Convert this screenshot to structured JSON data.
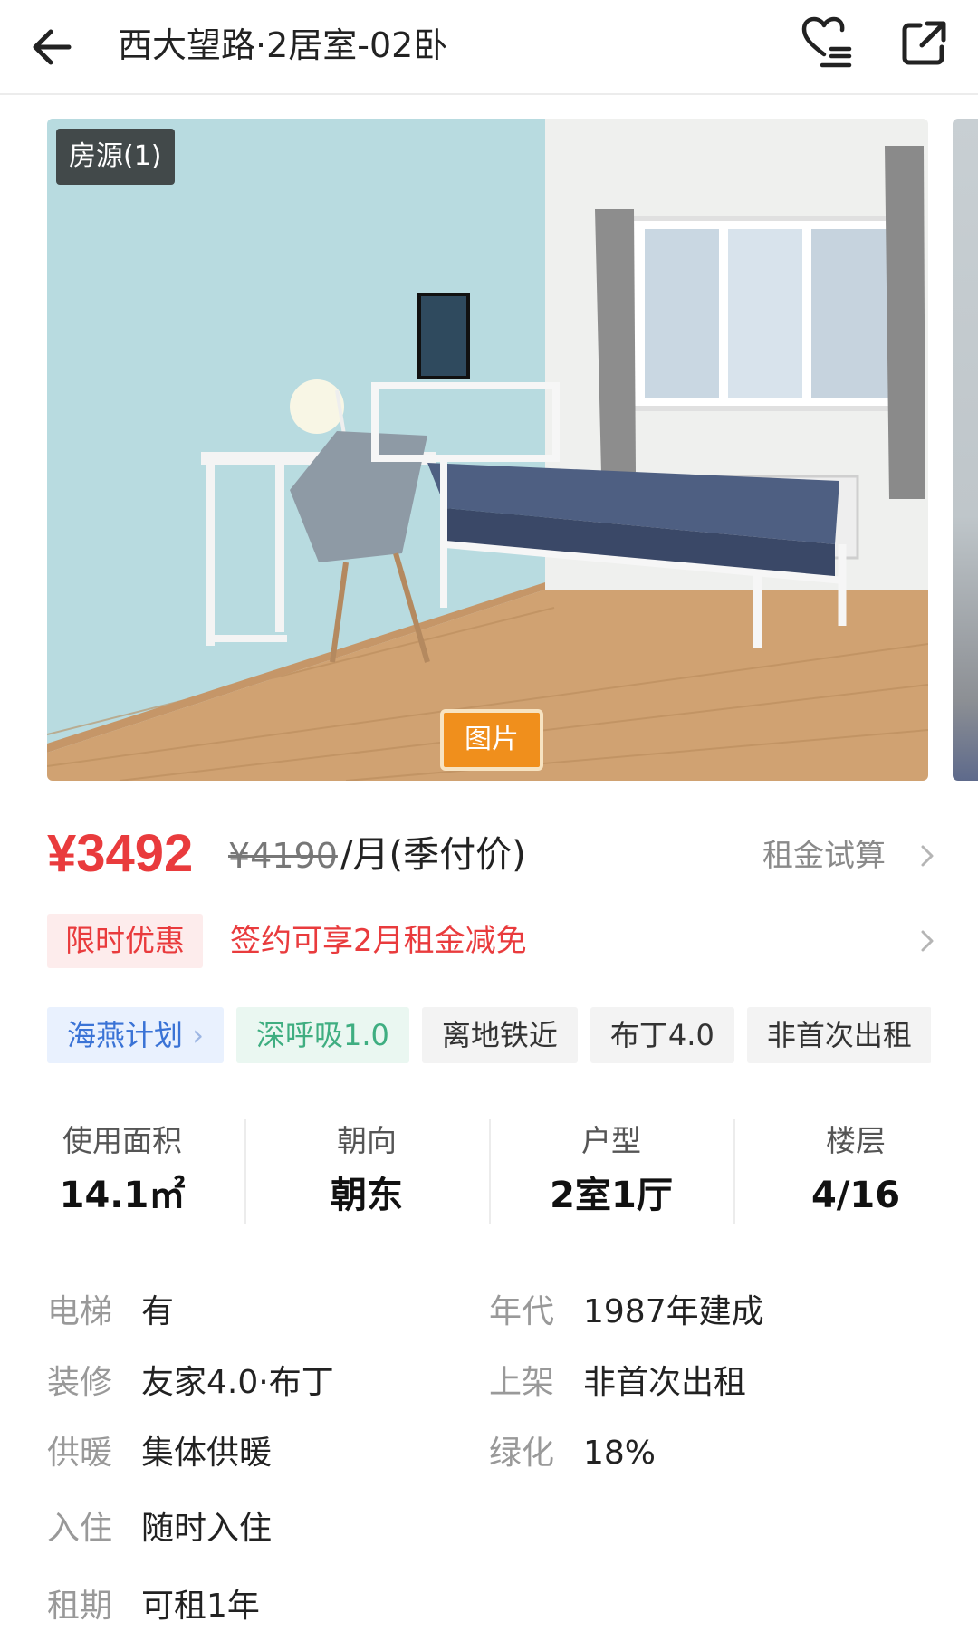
{
  "header": {
    "title": "西大望路·2居室-02卧"
  },
  "photo": {
    "source_badge": "房源(1)",
    "tab_label": "图片"
  },
  "price": {
    "current": "¥3492",
    "original": "¥4190",
    "unit": "/月(季付价)",
    "calc_link": "租金试算"
  },
  "promo": {
    "tag": "限时优惠",
    "text": "签约可享2月租金减免"
  },
  "tags": [
    {
      "label": "海燕计划"
    },
    {
      "label": "深呼吸1.0"
    },
    {
      "label": "离地铁近"
    },
    {
      "label": "布丁4.0"
    },
    {
      "label": "非首次出租"
    }
  ],
  "stats": [
    {
      "label": "使用面积",
      "value": "14.1㎡"
    },
    {
      "label": "朝向",
      "value": "朝东"
    },
    {
      "label": "户型",
      "value": "2室1厅"
    },
    {
      "label": "楼层",
      "value": "4/16"
    }
  ],
  "details": [
    {
      "key": "电梯",
      "value": "有"
    },
    {
      "key": "年代",
      "value": "1987年建成"
    },
    {
      "key": "装修",
      "value": "友家4.0·布丁"
    },
    {
      "key": "上架",
      "value": "非首次出租"
    },
    {
      "key": "供暖",
      "value": "集体供暖"
    },
    {
      "key": "绿化",
      "value": "18%"
    },
    {
      "key": "入住",
      "value": "随时入住"
    },
    {
      "key": "租期",
      "value": "可租1年"
    }
  ],
  "colors": {
    "accent_red": "#e93b3d",
    "photo_tab": "#f08f1c",
    "tag_blue": "#3a73d6",
    "tag_green": "#3fae81"
  },
  "icons": [
    "back-arrow-icon",
    "heart-list-icon",
    "share-icon",
    "chevron-right-icon"
  ]
}
